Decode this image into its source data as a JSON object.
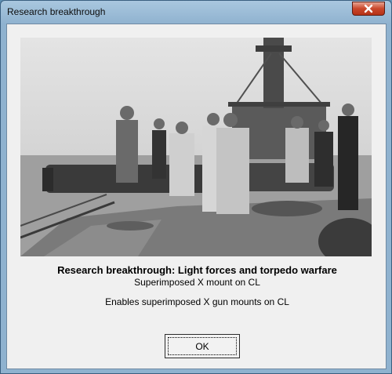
{
  "window": {
    "title": "Research breakthrough"
  },
  "dialog": {
    "heading": "Research breakthrough: Light forces and torpedo warfare",
    "subheading": "Superimposed X mount on CL",
    "description": "Enables superimposed X gun mounts on CL",
    "ok_label": "OK"
  },
  "icons": {
    "close": "close-icon"
  },
  "colors": {
    "close_button": "#c9472b",
    "client_background": "#f0f0f0",
    "title_bar": "#a9c7df"
  }
}
